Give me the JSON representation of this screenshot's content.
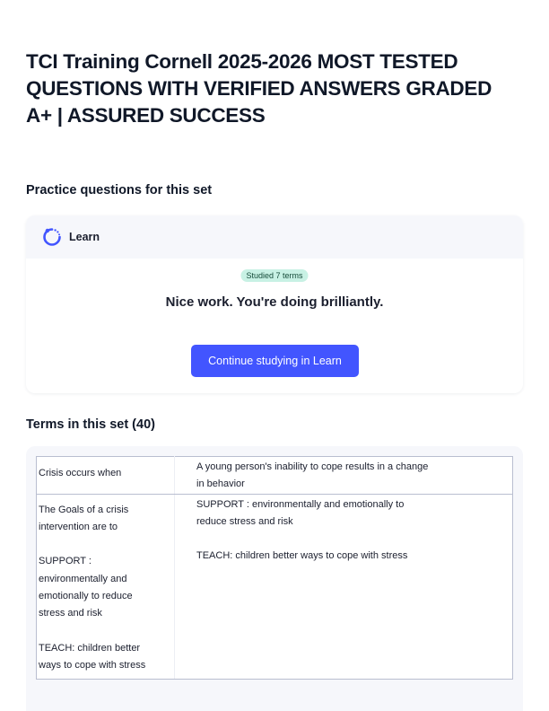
{
  "document": {
    "title_lines": [
      "TCI Training Cornell 2025-2026 MOST TESTED",
      "QUESTIONS WITH VERIFIED ANSWERS GRADED",
      "A+ | ASSURED SUCCESS"
    ]
  },
  "practice": {
    "heading": "Practice questions for this set",
    "learn_label": "Learn",
    "learn_icon": "learn-progress-icon",
    "studied_badge": "Studied 7 terms",
    "message": "Nice work. You're doing brilliantly.",
    "continue_label": "Continue studying in Learn",
    "accent_color": "#4255ff",
    "badge_color": "#c8f1e4"
  },
  "terms": {
    "heading": "Terms in this set (40)",
    "rows": [
      {
        "term_lines": [
          "Crisis occurs when"
        ],
        "definition_lines": [
          "A young person's inability to cope results in a change",
          "in behavior"
        ]
      },
      {
        "term_lines": [
          "The Goals of a crisis",
          "intervention are to",
          "",
          "SUPPORT :",
          "environmentally and",
          "emotionally to reduce",
          "stress and risk",
          "",
          "TEACH: children better",
          "ways to cope with stress"
        ],
        "definition_lines": [
          "SUPPORT : environmentally and emotionally to",
          "reduce stress and risk",
          "",
          "TEACH: children better ways to cope with stress"
        ]
      }
    ]
  }
}
